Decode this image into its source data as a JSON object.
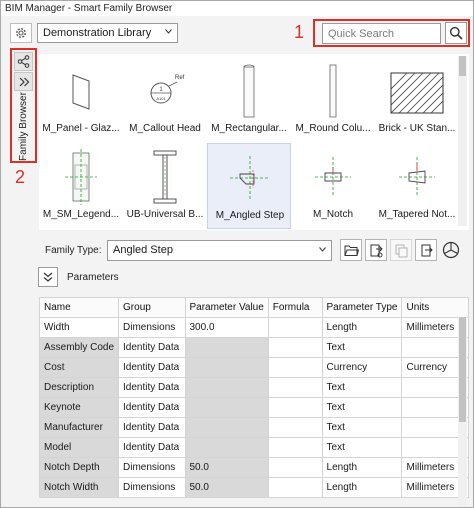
{
  "window": {
    "title": "BIM Manager - Smart Family Browser"
  },
  "toolbar": {
    "library_selected": "Demonstration Library",
    "search_placeholder": "Quick Search"
  },
  "annotations": {
    "search_callout": "1",
    "sidebar_callout": "2"
  },
  "sidebar": {
    "tab_label": "Family Browser"
  },
  "families": [
    {
      "label": "M_Panel - Glaz..."
    },
    {
      "label": "M_Callout Head"
    },
    {
      "label": "M_Rectangular..."
    },
    {
      "label": "M_Round Colu..."
    },
    {
      "label": "Brick - UK Stan..."
    },
    {
      "label": "M_SM_Legend..."
    },
    {
      "label": "UB-Universal B..."
    },
    {
      "label": "M_Angled Step"
    },
    {
      "label": "M_Notch"
    },
    {
      "label": "M_Tapered Not..."
    }
  ],
  "family_type": {
    "label": "Family Type:",
    "selected": "Angled Step"
  },
  "parameters": {
    "label": "Parameters",
    "columns": [
      "Name",
      "Group",
      "Parameter Value",
      "Formula",
      "Parameter Type",
      "Units"
    ],
    "rows": [
      {
        "name": "Width",
        "group": "Dimensions",
        "value": "300.0",
        "formula": "",
        "type": "Length",
        "units": "Millimeters"
      },
      {
        "name": "Assembly Code",
        "group": "Identity Data",
        "value": "",
        "formula": "",
        "type": "Text",
        "units": ""
      },
      {
        "name": "Cost",
        "group": "Identity Data",
        "value": "",
        "formula": "",
        "type": "Currency",
        "units": "Currency"
      },
      {
        "name": "Description",
        "group": "Identity Data",
        "value": "",
        "formula": "",
        "type": "Text",
        "units": ""
      },
      {
        "name": "Keynote",
        "group": "Identity Data",
        "value": "",
        "formula": "",
        "type": "Text",
        "units": ""
      },
      {
        "name": "Manufacturer",
        "group": "Identity Data",
        "value": "",
        "formula": "",
        "type": "Text",
        "units": ""
      },
      {
        "name": "Model",
        "group": "Identity Data",
        "value": "",
        "formula": "",
        "type": "Text",
        "units": ""
      },
      {
        "name": "Notch Depth",
        "group": "Dimensions",
        "value": "50.0",
        "formula": "",
        "type": "Length",
        "units": "Millimeters"
      },
      {
        "name": "Notch Width",
        "group": "Dimensions",
        "value": "50.0",
        "formula": "",
        "type": "Length",
        "units": "Millimeters"
      }
    ]
  },
  "colors": {
    "annotation_red": "#d9302a",
    "selection": "#e9eef8",
    "readonly_cell": "#d9d9d9"
  }
}
